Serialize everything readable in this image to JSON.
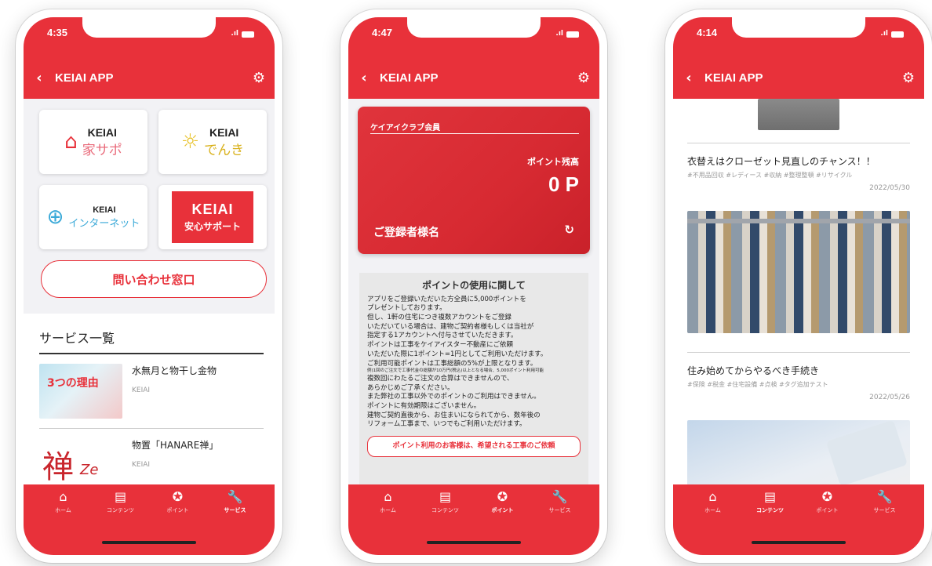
{
  "colors": {
    "accent": "#e8313a"
  },
  "app": {
    "back_icon": "chevron-left-icon",
    "title": "KEIAI APP",
    "settings_icon": "gear-icon"
  },
  "tabbar": {
    "items": [
      {
        "label": "ホーム",
        "icon": "home-icon"
      },
      {
        "label": "コンテンツ",
        "icon": "document-icon"
      },
      {
        "label": "ポイント",
        "icon": "star-icon"
      },
      {
        "label": "サービス",
        "icon": "wrench-icon"
      }
    ]
  },
  "phone1": {
    "time": "4:35",
    "tiles": [
      {
        "brand": "KEIAI",
        "sub": "家サポ",
        "icon": "house-icon"
      },
      {
        "brand": "KEIAI",
        "sub": "でんき",
        "icon": "bulb-icon"
      },
      {
        "brand": "KEIAI",
        "sub": "インターネット",
        "icon": "globe-icon"
      },
      {
        "brand": "KEIAI",
        "sub": "安心サポート"
      }
    ],
    "contact_button": "問い合わせ窓口",
    "services_title": "サービス一覧",
    "services": [
      {
        "thumb_text": "3つの理由",
        "name": "水無月と物干し金物",
        "source": "KEIAI"
      },
      {
        "thumb_text": "禅",
        "thumb_sub": "Ze",
        "name": "物置「HANARE禅」",
        "source": "KEIAI"
      }
    ],
    "active_tab": "サービス"
  },
  "phone2": {
    "time": "4:47",
    "card": {
      "member_label": "ケイアイクラブ会員",
      "points_label": "ポイント残高",
      "points_value": "0 P",
      "holder": "ご登録者様名"
    },
    "notice": {
      "title": "ポイントの使用に関して",
      "lines": [
        "アプリをご登録いただいた方全員に5,000ポイントを",
        "プレゼントしております。",
        "但し、1軒の住宅につき複数アカウントをご登録",
        "いただいている場合は、建物ご契約者様もしくは当社が",
        "指定する1アカウントへ付与させていただきます。",
        "ポイントは工事をケイアイスター不動産にご依頼",
        "いただいた際に1ポイント=1円としてご利用いただけます。",
        "ご利用可能ポイントは工事総額の5%が上限となります。"
      ],
      "small_line": "例)1回のご注文で工事代金の総額が10万円(税込)以上となる場合、5,000ポイント利用可能",
      "lines2": [
        "複数回にわたるご注文の合算はできませんので、",
        "あらかじめご了承ください。",
        "また弊社の工事以外でのポイントのご利用はできません。",
        "ポイントに有効期限はございません。",
        "建物ご契約直後から、お住まいになられてから、数年後の",
        "リフォーム工事まで、いつでもご利用いただけます。"
      ],
      "button": "ポイント利用のお客様は、希望される工事のご依頼"
    },
    "active_tab": "ポイント"
  },
  "phone3": {
    "time": "4:14",
    "articles": [
      {
        "title": "衣替えはクローゼット見直しのチャンス！！",
        "tags": "#不用品回収 #レディース #収納 #整理整頓 #リサイクル",
        "date": "2022/05/30"
      },
      {
        "title": "住み始めてからやるべき手続き",
        "tags": "#保険 #税金 #住宅設備 #点検 #タグ追加テスト",
        "date": "2022/05/26"
      }
    ],
    "active_tab": "コンテンツ"
  }
}
